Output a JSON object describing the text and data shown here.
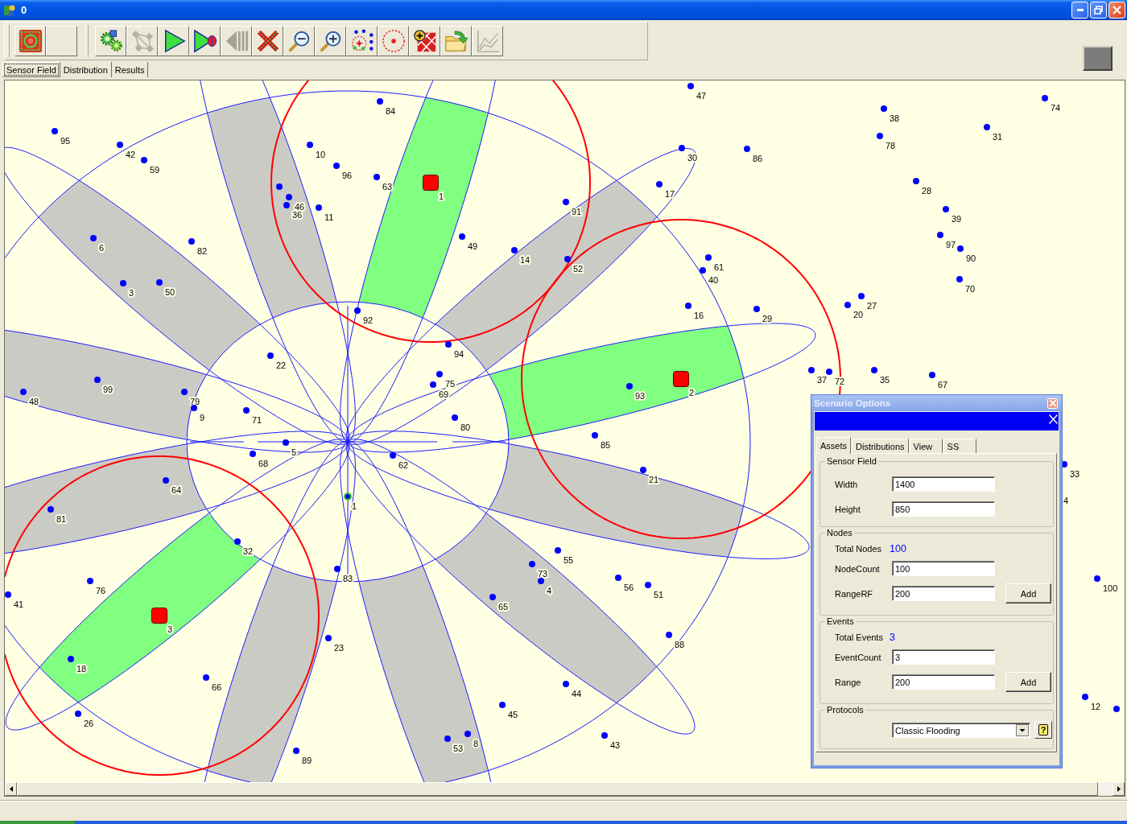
{
  "window": {
    "title": "0"
  },
  "toolbar": {
    "groups": [
      {
        "buttons": [
          {
            "kind": "target",
            "disabled": false
          },
          {
            "kind": "blank"
          }
        ]
      },
      {
        "buttons": [
          {
            "kind": "gears",
            "disabled": false
          },
          {
            "kind": "network",
            "disabled": true
          },
          {
            "kind": "play",
            "disabled": false
          },
          {
            "kind": "playstop",
            "disabled": false
          },
          {
            "kind": "rewind",
            "disabled": true
          },
          {
            "kind": "cross",
            "disabled": false
          },
          {
            "kind": "zoomout",
            "disabled": false
          },
          {
            "kind": "zoomin",
            "disabled": false
          },
          {
            "kind": "scatter",
            "disabled": false
          },
          {
            "kind": "range",
            "disabled": false
          },
          {
            "kind": "puzzle",
            "disabled": false
          },
          {
            "kind": "folder",
            "disabled": false
          },
          {
            "kind": "chart",
            "disabled": true
          }
        ]
      }
    ]
  },
  "tabs": [
    {
      "label": "Sensor Field",
      "selected": true
    },
    {
      "label": "Distribution",
      "selected": false
    },
    {
      "label": "Results",
      "selected": false
    }
  ],
  "sensor_field": {
    "sectors": [
      {
        "active": false
      },
      {
        "active": true
      },
      {
        "active": false
      },
      {
        "active": true
      },
      {
        "active": false
      },
      {
        "active": false
      },
      {
        "active": false
      },
      {
        "active": false
      },
      {
        "active": true
      },
      {
        "active": false
      },
      {
        "active": false
      },
      {
        "active": false
      }
    ],
    "events": [
      {
        "label": "1"
      },
      {
        "label": "2"
      },
      {
        "label": "3"
      }
    ],
    "sink": {
      "label": "1"
    },
    "nodes": [
      {
        "kind": "node",
        "label": "47"
      },
      {
        "kind": "node",
        "label": "84"
      },
      {
        "kind": "node",
        "label": "74"
      },
      {
        "kind": "node",
        "label": "38"
      },
      {
        "kind": "node",
        "label": "31"
      },
      {
        "kind": "node",
        "label": "95"
      },
      {
        "kind": "node",
        "label": "78"
      },
      {
        "kind": "node",
        "label": "42"
      },
      {
        "kind": "node",
        "label": "10"
      },
      {
        "kind": "node",
        "label": "30"
      },
      {
        "kind": "node",
        "label": "86"
      },
      {
        "kind": "node",
        "label": "59"
      },
      {
        "kind": "node",
        "label": "96"
      },
      {
        "kind": "node",
        "label": "63"
      },
      {
        "kind": "dot"
      },
      {
        "kind": "node",
        "label": "17"
      },
      {
        "kind": "node",
        "label": "28"
      },
      {
        "kind": "node",
        "label": "46"
      },
      {
        "kind": "node",
        "label": "36"
      },
      {
        "kind": "node",
        "label": "11"
      },
      {
        "kind": "node",
        "label": "91"
      },
      {
        "kind": "node",
        "label": "39"
      },
      {
        "kind": "node",
        "label": "6"
      },
      {
        "kind": "node",
        "label": "82"
      },
      {
        "kind": "node",
        "label": "49"
      },
      {
        "kind": "node",
        "label": "97"
      },
      {
        "kind": "node",
        "label": "14"
      },
      {
        "kind": "node",
        "label": "90"
      },
      {
        "kind": "node",
        "label": "52"
      },
      {
        "kind": "node",
        "label": "61"
      },
      {
        "kind": "node",
        "label": "40"
      },
      {
        "kind": "node",
        "label": "3"
      },
      {
        "kind": "node",
        "label": "50"
      },
      {
        "kind": "node",
        "label": "70"
      },
      {
        "kind": "node",
        "label": "27"
      },
      {
        "kind": "node",
        "label": "92"
      },
      {
        "kind": "node",
        "label": "16"
      },
      {
        "kind": "node",
        "label": "29"
      },
      {
        "kind": "node",
        "label": "20"
      },
      {
        "kind": "node",
        "label": "94"
      },
      {
        "kind": "node",
        "label": "22"
      },
      {
        "kind": "node",
        "label": "75"
      },
      {
        "kind": "node",
        "label": "37"
      },
      {
        "kind": "node",
        "label": "72"
      },
      {
        "kind": "node",
        "label": "35"
      },
      {
        "kind": "node",
        "label": "67"
      },
      {
        "kind": "node",
        "label": "99"
      },
      {
        "kind": "node",
        "label": "69"
      },
      {
        "kind": "node",
        "label": "93"
      },
      {
        "kind": "node",
        "label": "48"
      },
      {
        "kind": "node",
        "label": "79"
      },
      {
        "kind": "node",
        "label": "9"
      },
      {
        "kind": "node",
        "label": "71"
      },
      {
        "kind": "node",
        "label": "80"
      },
      {
        "kind": "node",
        "label": "85"
      },
      {
        "kind": "node",
        "label": "5"
      },
      {
        "kind": "node",
        "label": "68"
      },
      {
        "kind": "node",
        "label": "62"
      },
      {
        "kind": "node",
        "label": "33"
      },
      {
        "kind": "node",
        "label": "21"
      },
      {
        "kind": "node",
        "label": "64"
      },
      {
        "kind": "label",
        "label": "4"
      },
      {
        "kind": "node",
        "label": "81"
      },
      {
        "kind": "node",
        "label": "32"
      },
      {
        "kind": "node",
        "label": "55"
      },
      {
        "kind": "node",
        "label": "73"
      },
      {
        "kind": "node",
        "label": "83"
      },
      {
        "kind": "node",
        "label": "76"
      },
      {
        "kind": "node",
        "label": "4"
      },
      {
        "kind": "node",
        "label": "56"
      },
      {
        "kind": "node",
        "label": "100"
      },
      {
        "kind": "node",
        "label": "51"
      },
      {
        "kind": "node",
        "label": "41"
      },
      {
        "kind": "node",
        "label": "65"
      },
      {
        "kind": "node",
        "label": "23"
      },
      {
        "kind": "node",
        "label": "88"
      },
      {
        "kind": "node",
        "label": "18"
      },
      {
        "kind": "node",
        "label": "66"
      },
      {
        "kind": "node",
        "label": "44"
      },
      {
        "kind": "node",
        "label": "12"
      },
      {
        "kind": "node",
        "label": "45"
      },
      {
        "kind": "dot"
      },
      {
        "kind": "node",
        "label": "26"
      },
      {
        "kind": "node",
        "label": "53"
      },
      {
        "kind": "node",
        "label": "8"
      },
      {
        "kind": "node",
        "label": "43"
      },
      {
        "kind": "node",
        "label": "89"
      }
    ]
  },
  "dialog": {
    "title": "Scenario Options",
    "tabs": [
      {
        "label": "Assets",
        "selected": true
      },
      {
        "label": "Distributions",
        "selected": false
      },
      {
        "label": "View",
        "selected": false
      },
      {
        "label": "SS",
        "selected": false
      }
    ],
    "groups": [
      {
        "title": "Sensor Field",
        "rows": [
          {
            "kind": "input",
            "label": "Width",
            "value": "1400"
          },
          {
            "kind": "input",
            "label": "Height",
            "value": "850"
          }
        ]
      },
      {
        "title": "Nodes",
        "rows": [
          {
            "kind": "total",
            "label": "Total Nodes",
            "value": "100"
          },
          {
            "kind": "input",
            "label": "NodeCount",
            "value": "100"
          },
          {
            "kind": "input",
            "label": "RangeRF",
            "value": "200",
            "button": "Add"
          }
        ]
      },
      {
        "title": "Events",
        "rows": [
          {
            "kind": "total",
            "label": "Total Events",
            "value": "3"
          },
          {
            "kind": "input",
            "label": "EventCount",
            "value": "3"
          },
          {
            "kind": "input",
            "label": "Range",
            "value": "200",
            "button": "Add"
          }
        ]
      },
      {
        "title": "Protocols",
        "rows": [
          {
            "kind": "select",
            "value": "Classic Flooding",
            "help": "?"
          }
        ]
      }
    ]
  }
}
